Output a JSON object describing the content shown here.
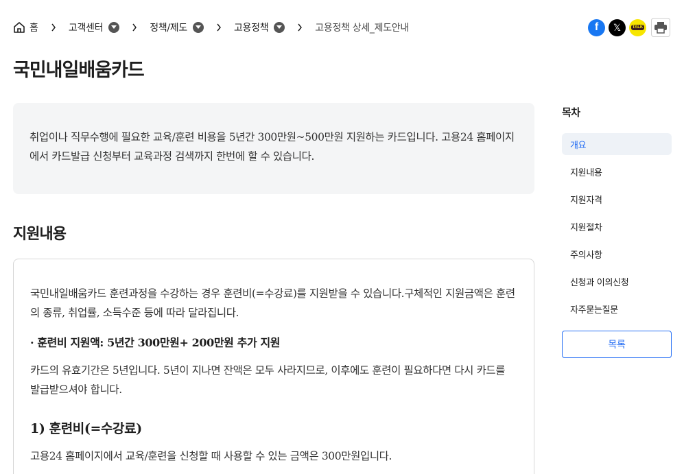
{
  "breadcrumb": {
    "home": "홈",
    "items": [
      "고객센터",
      "정책/제도",
      "고용정책"
    ],
    "current": "고용정책 상세_제도안내"
  },
  "share": {
    "icons": [
      "facebook-icon",
      "x-icon",
      "kakaotalk-icon",
      "print-icon"
    ],
    "kakao_text": "TALK"
  },
  "page_title": "국민내일배움카드",
  "intro": {
    "text": "취업이나 직무수행에 필요한 교육/훈련 비용을 5년간 300만원~500만원 지원하는 카드입니다. 고용24 홈페이지에서 카드발급 신청부터 교육과정 검색까지 한번에 할 수 있습니다."
  },
  "section": {
    "title": "지원내용",
    "p1": "국민내일배움카드 훈련과정을 수강하는 경우 훈련비(=수강료)를 지원받을 수 있습니다.구체적인 지원금액은 훈련의 종류, 취업률, 소득수준 등에 따라 달라집니다.",
    "bullet": "· 훈련비 지원액: 5년간 300만원+ 200만원 추가 지원",
    "p2": "카드의 유효기간은 5년입니다. 5년이 지나면 잔액은 모두 사라지므로, 이후에도 훈련이 필요하다면 다시 카드를 발급받으셔야 합니다.",
    "h3": "1) 훈련비(=수강료)",
    "p3": "고용24 홈페이지에서 교육/훈련을 신청할 때 사용할 수 있는 금액은 300만원입니다."
  },
  "toc": {
    "title": "목차",
    "items": [
      "개요",
      "지원내용",
      "지원자격",
      "지원절차",
      "주의사항",
      "신청과 이의신청",
      "자주묻는질문"
    ],
    "active_index": 0,
    "list_button": "목록"
  },
  "colors": {
    "accent": "#256ef4",
    "facebook": "#1877f2",
    "kakao": "#f7e600",
    "intro_bg": "#f4f5f6"
  }
}
